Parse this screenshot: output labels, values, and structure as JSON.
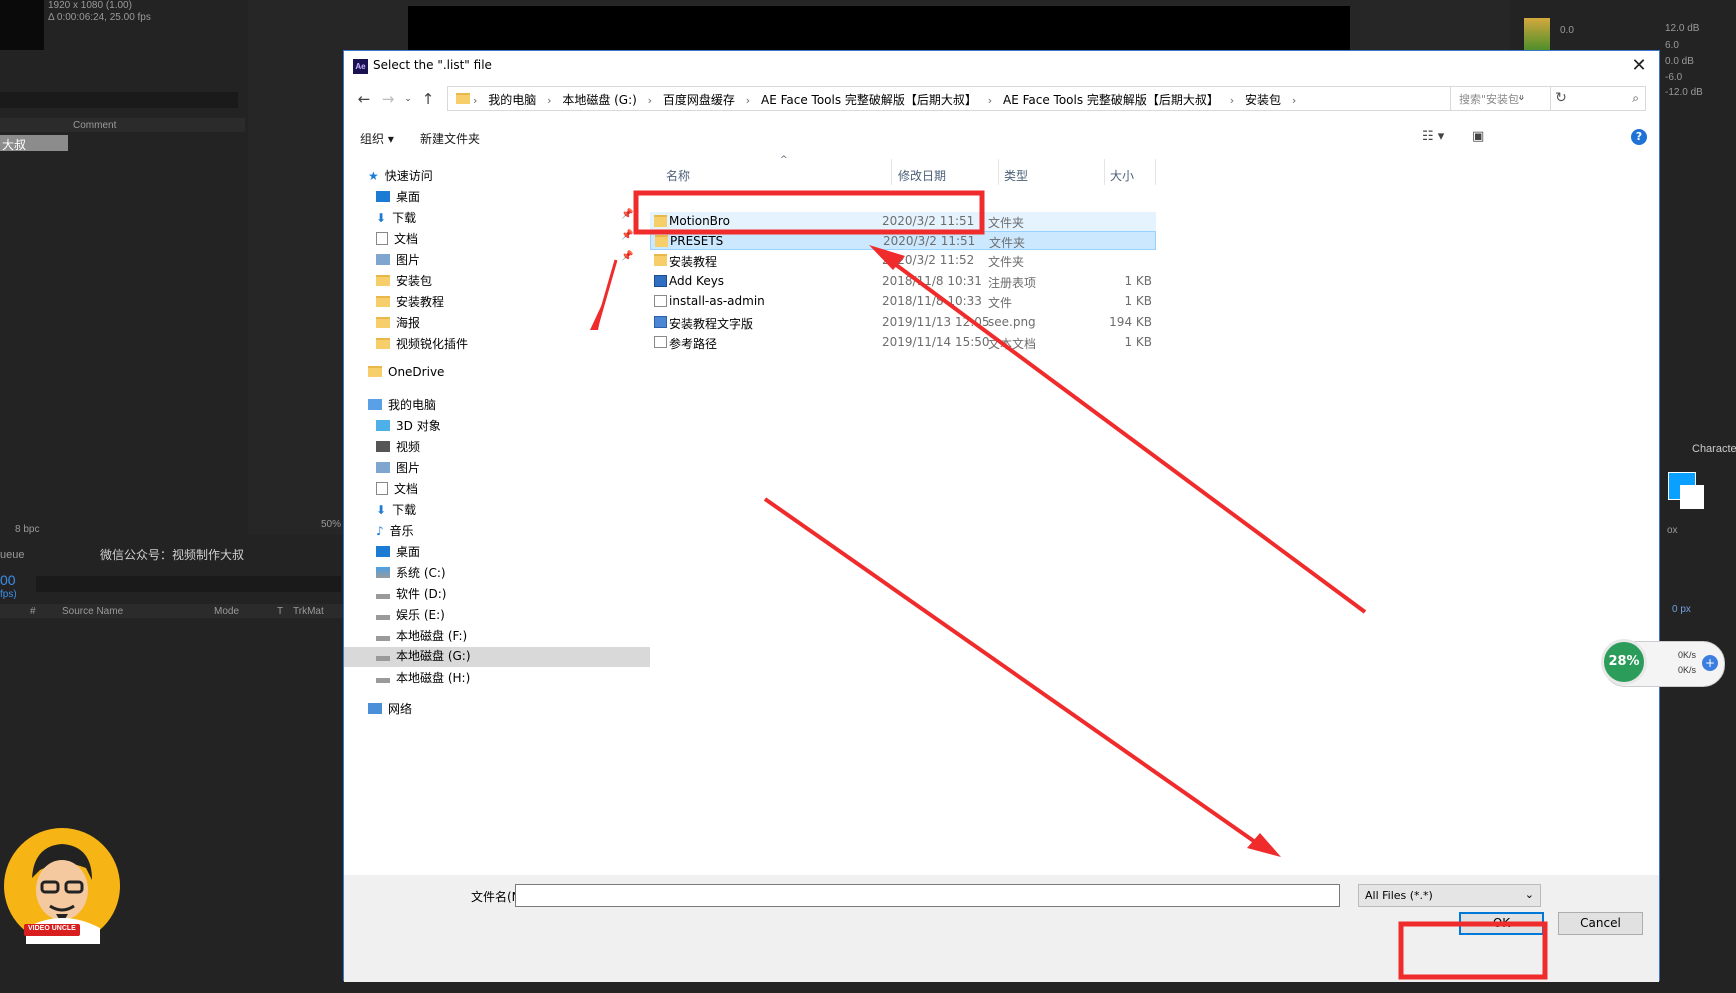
{
  "ae_background": {
    "comp_info_line1": "1920 x 1080 (1.00)",
    "comp_info_line2": "Δ 0:00:06:24, 25.00 fps",
    "comment_header": "Comment",
    "layer_label": "大叔",
    "bpc": "8 bpc",
    "zoom": "50%",
    "queue_label": "ueue",
    "comp_tab": "微信公众号：视频制作大叔",
    "timecode": "00",
    "fps_label": "fps)",
    "col_hash": "#",
    "col_source_name": "Source Name",
    "col_mode": "Mode",
    "col_t": "T",
    "col_trkmat": "TrkMat",
    "meter_labels": [
      "12.0 dB",
      "6.0",
      "0.0 dB",
      "-6.0",
      "-12.0 dB"
    ],
    "meter_left": [
      "0.0",
      "-6.0"
    ],
    "character_tab": "Characte",
    "px_label": "0 px",
    "ox_label": "ox"
  },
  "dialog": {
    "title": "Select the \".list\" file",
    "title_icon": "Ae",
    "breadcrumbs": [
      "我的电脑",
      "本地磁盘 (G:)",
      "百度网盘缓存",
      "AE Face Tools 完整破解版【后期大叔】",
      "AE Face Tools 完整破解版【后期大叔】",
      "安装包"
    ],
    "search_placeholder": "搜索\"安装包\"",
    "toolbar": {
      "organize": "组织 ▾",
      "new_folder": "新建文件夹"
    },
    "nav": {
      "quick_access": "快速访问",
      "quick_items": [
        "桌面",
        "下载",
        "文档",
        "图片",
        "安装包",
        "安装教程",
        "海报",
        "视频锐化插件"
      ],
      "onedrive": "OneDrive",
      "this_pc": "我的电脑",
      "pc_items": [
        "3D 对象",
        "视频",
        "图片",
        "文档",
        "下载",
        "音乐",
        "桌面",
        "系统 (C:)",
        "软件 (D:)",
        "娱乐 (E:)",
        "本地磁盘 (F:)",
        "本地磁盘 (G:)",
        "本地磁盘 (H:)"
      ],
      "network": "网络"
    },
    "columns": {
      "name": "名称",
      "date": "修改日期",
      "type": "类型",
      "size": "大小"
    },
    "files": [
      {
        "name": "MotionBro",
        "date": "2020/3/2 11:51",
        "type": "文件夹",
        "size": ""
      },
      {
        "name": "PRESETS",
        "date": "2020/3/2 11:51",
        "type": "文件夹",
        "size": ""
      },
      {
        "name": "安装教程",
        "date": "2020/3/2 11:52",
        "type": "文件夹",
        "size": ""
      },
      {
        "name": "Add Keys",
        "date": "2018/11/8 10:31",
        "type": "注册表项",
        "size": "1 KB"
      },
      {
        "name": "install-as-admin",
        "date": "2018/11/8 10:33",
        "type": "文件",
        "size": "1 KB"
      },
      {
        "name": "安装教程文字版",
        "date": "2019/11/13 12:05",
        "type": "see.png",
        "size": "194 KB"
      },
      {
        "name": "参考路径",
        "date": "2019/11/14 15:50",
        "type": "文本文档",
        "size": "1 KB"
      }
    ],
    "filename_label": "文件名(N):",
    "filename_value": "",
    "filetype": "All Files (*.*)",
    "ok": "OK",
    "cancel": "Cancel"
  },
  "speed_widget": {
    "percent": "28%",
    "up": "0K/s",
    "down": "0K/s"
  },
  "avatar_text": "VIDEO UNCLE",
  "annotation_color": "#f02b2b"
}
